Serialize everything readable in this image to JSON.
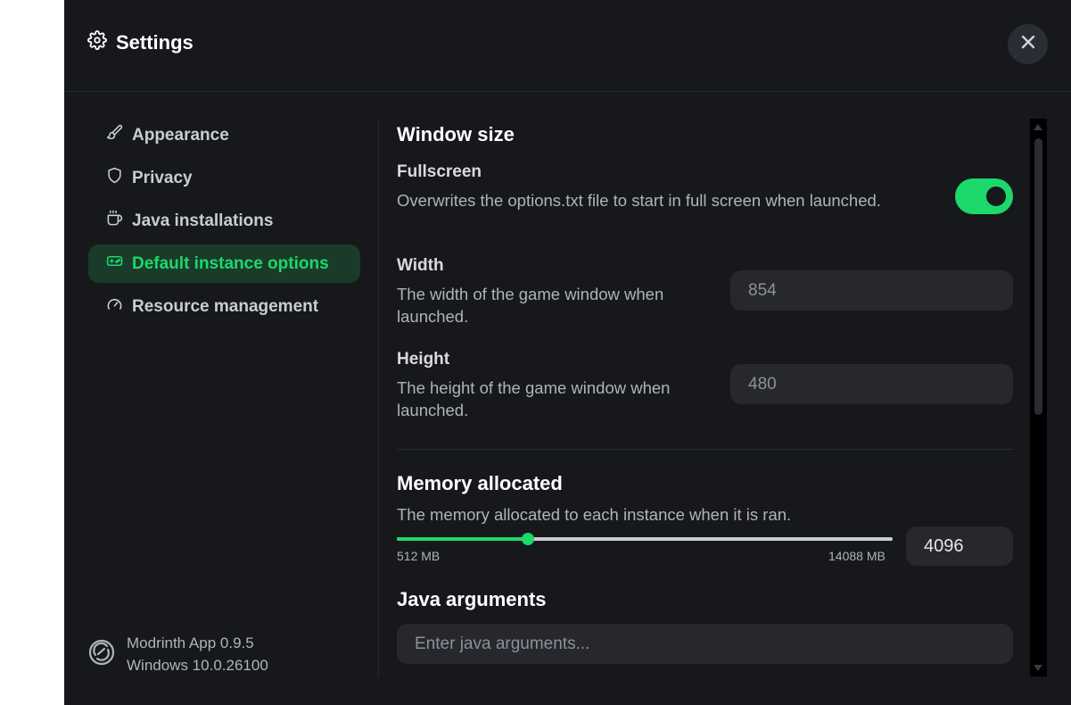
{
  "header": {
    "title": "Settings",
    "icon": "gear-icon"
  },
  "sidebar": {
    "items": [
      {
        "label": "Appearance",
        "icon": "paintbrush-icon",
        "active": false
      },
      {
        "label": "Privacy",
        "icon": "shield-icon",
        "active": false
      },
      {
        "label": "Java installations",
        "icon": "coffee-icon",
        "active": false
      },
      {
        "label": "Default instance options",
        "icon": "gamepad-icon",
        "active": true
      },
      {
        "label": "Resource management",
        "icon": "gauge-icon",
        "active": false
      }
    ]
  },
  "footer": {
    "app_version": "Modrinth App 0.9.5",
    "os_version": "Windows 10.0.26100"
  },
  "content": {
    "window_size": {
      "title": "Window size",
      "fullscreen": {
        "label": "Fullscreen",
        "description": "Overwrites the options.txt file to start in full screen when launched.",
        "enabled": true
      },
      "width": {
        "label": "Width",
        "description": "The width of the game window when launched.",
        "placeholder": "854"
      },
      "height": {
        "label": "Height",
        "description": "The height of the game window when launched.",
        "placeholder": "480"
      }
    },
    "memory": {
      "title": "Memory allocated",
      "description": "The memory allocated to each instance when it is ran.",
      "min_label": "512 MB",
      "max_label": "14088 MB",
      "min": 512,
      "max": 14088,
      "value": "4096"
    },
    "java_args": {
      "title": "Java arguments",
      "placeholder": "Enter java arguments..."
    }
  },
  "colors": {
    "accent": "#1bd96a",
    "background": "#16181c",
    "input_bg": "#26282e"
  }
}
